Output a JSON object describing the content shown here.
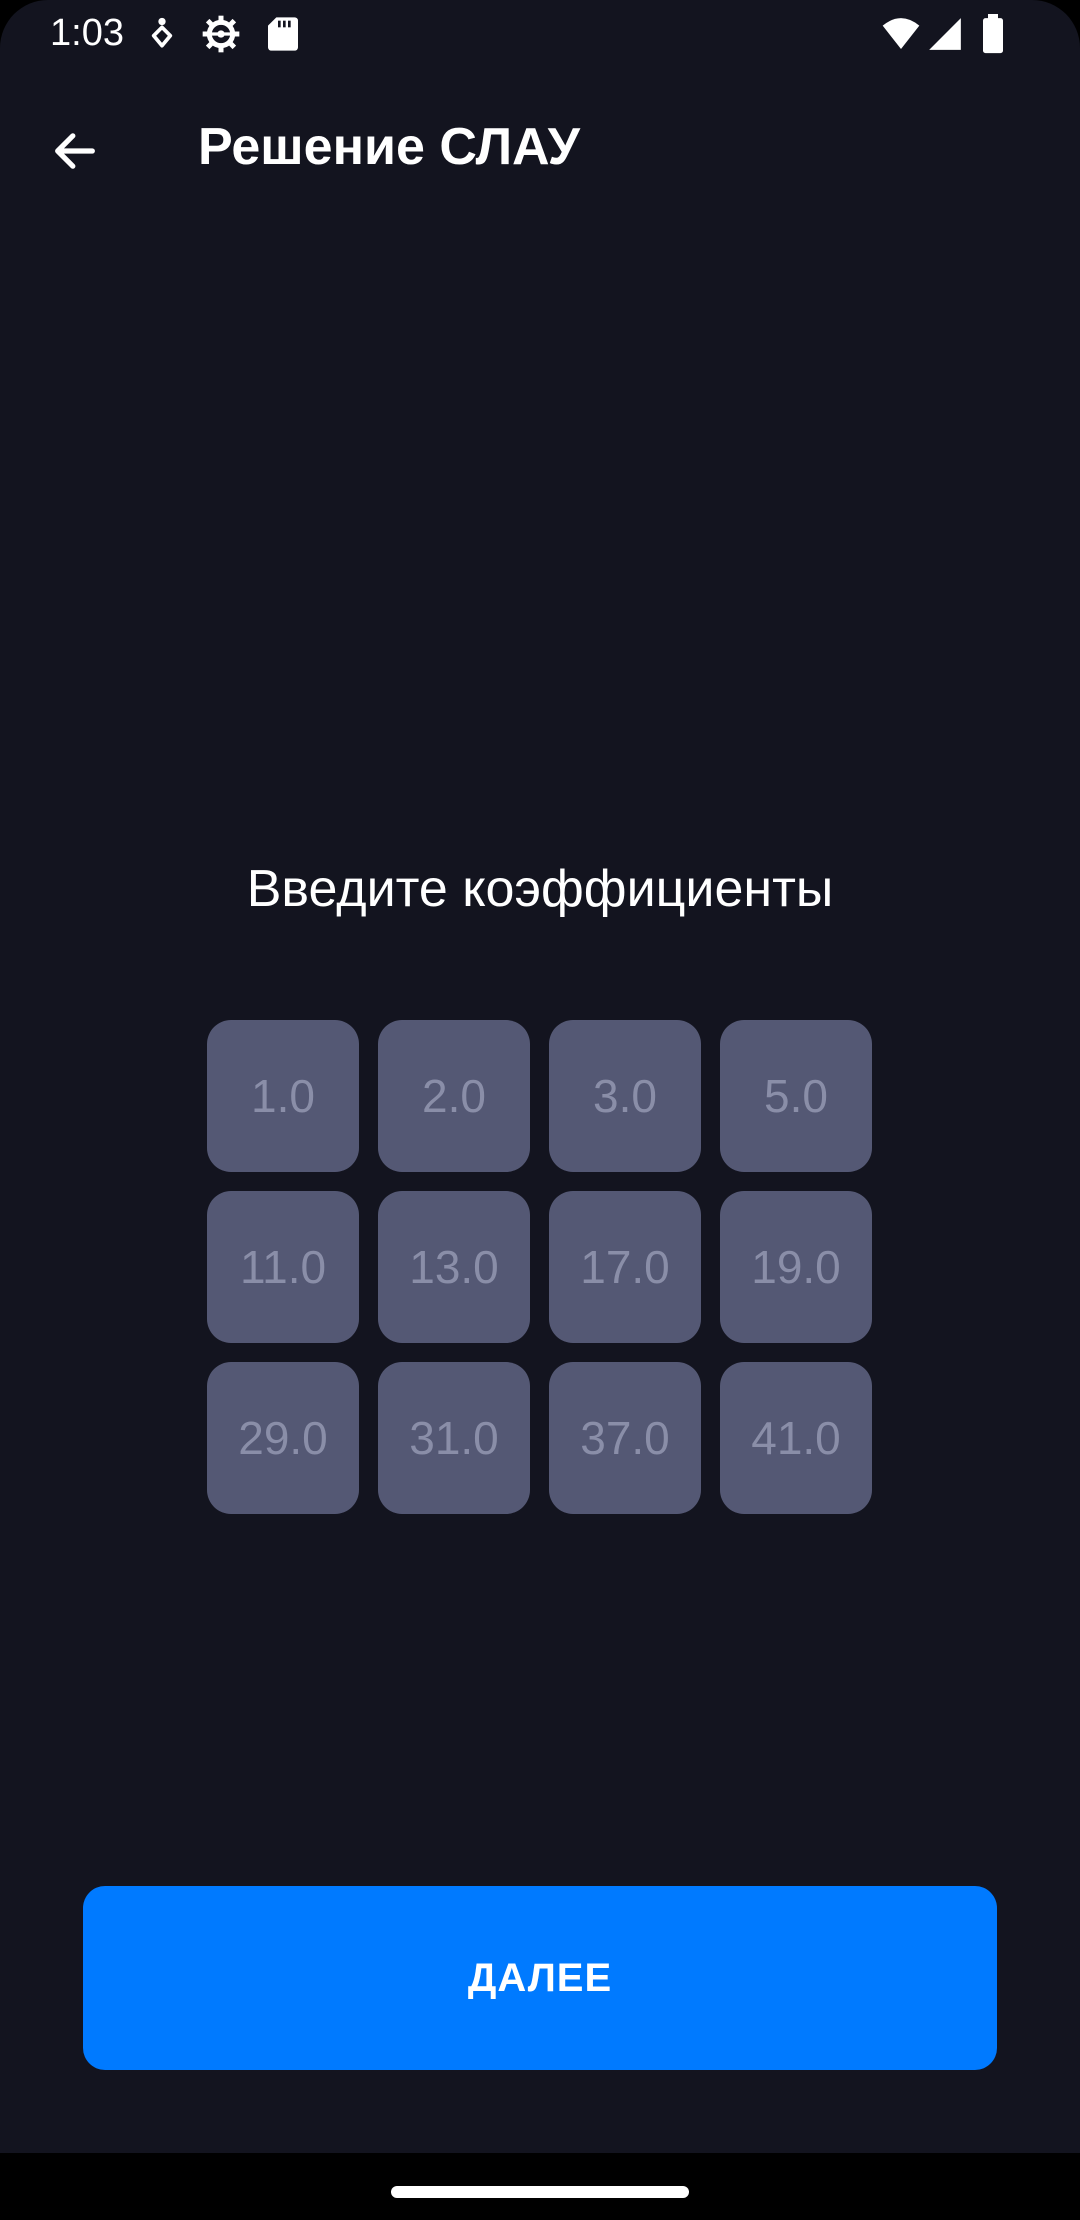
{
  "status_bar": {
    "time": "1:03",
    "left_icons": [
      "accessibility-icon",
      "settings-gear-icon",
      "sd-card-icon"
    ],
    "right_icons": [
      "wifi-icon",
      "cellular-signal-icon",
      "battery-icon"
    ]
  },
  "app_bar": {
    "back_icon": "arrow-back-icon",
    "title": "Решение СЛАУ"
  },
  "prompt": "Введите коэффициенты",
  "coefficients": {
    "rows": [
      [
        "1.0",
        "2.0",
        "3.0",
        "5.0"
      ],
      [
        "11.0",
        "13.0",
        "17.0",
        "19.0"
      ],
      [
        "29.0",
        "31.0",
        "37.0",
        "41.0"
      ]
    ]
  },
  "next_button": {
    "label": "ДАЛЕЕ"
  },
  "colors": {
    "background": "#13141f",
    "cell": "#545874",
    "cell_text": "#8a8ea8",
    "accent": "#007aff"
  }
}
